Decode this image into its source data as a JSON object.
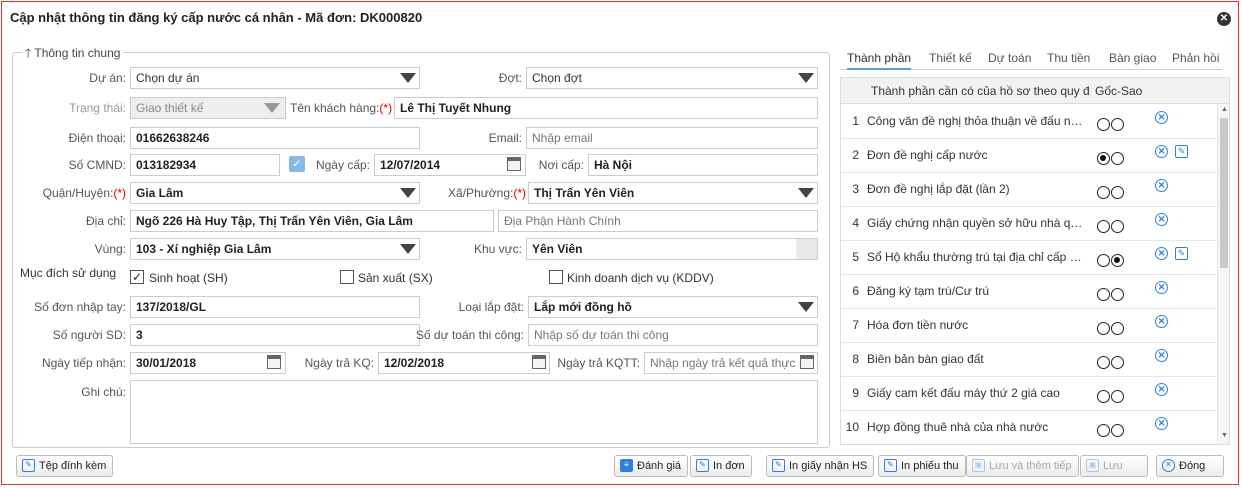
{
  "dialog": {
    "title": "Cập nhật thông tin đăng ký cấp nước cá nhân - Mã đơn: DK000820",
    "close_icon": "close-circle-icon"
  },
  "general": {
    "legend": "Thông tin chung",
    "du_an": {
      "label": "Dự án:",
      "value": "Chọn dự án"
    },
    "dot": {
      "label": "Đợt:",
      "value": "Chọn đợt"
    },
    "trang_thai": {
      "label": "Trạng thái:",
      "value": "Giao thiết kế"
    },
    "ten_kh": {
      "label": "Tên khách hàng:",
      "req": "(*)",
      "value": "Lê Thị Tuyết Nhung"
    },
    "dien_thoai": {
      "label": "Điện thoại:",
      "value": "01662638246"
    },
    "email": {
      "label": "Email:",
      "placeholder": "Nhập email"
    },
    "cmnd": {
      "label": "Số CMND:",
      "value": "013182934"
    },
    "ngay_cap": {
      "label": "Ngày cấp:",
      "value": "12/07/2014"
    },
    "noi_cap": {
      "label": "Nơi cấp:",
      "value": "Hà Nội"
    },
    "quan_huyen": {
      "label": "Quận/Huyện:",
      "req": "(*)",
      "value": "Gia Lâm"
    },
    "xa_phuong": {
      "label": "Xã/Phường:",
      "req": "(*)",
      "value": "Thị Trấn Yên Viên"
    },
    "dia_chi": {
      "label": "Địa chỉ:",
      "value": "Ngõ 226 Hà Huy Tập, Thị Trấn Yên Viên, Gia Lâm",
      "admin_placeholder": "Địa Phận Hành Chính"
    },
    "vung": {
      "label": "Vùng:",
      "value": "103 - Xí nghiệp Gia Lâm"
    },
    "khu_vuc": {
      "label": "Khu vực:",
      "value": "Yên Viên"
    },
    "muc_dich": {
      "label": "Mục đích sử dụng",
      "options": [
        {
          "label": "Sinh hoạt (SH)",
          "checked": true
        },
        {
          "label": "Sản xuất (SX)",
          "checked": false
        },
        {
          "label": "Kinh doanh dịch vụ (KDDV)",
          "checked": false
        }
      ]
    },
    "so_don": {
      "label": "Số đơn nhập tay:",
      "value": "137/2018/GL"
    },
    "loai_lap_dat": {
      "label": "Loại lắp đặt:",
      "value": "Lắp mới đồng hồ"
    },
    "so_nguoi": {
      "label": "Số người SD:",
      "value": "3"
    },
    "so_du_toan": {
      "label": "Số dự toán thi công:",
      "placeholder": "Nhập số dự toán thi công"
    },
    "ngay_tiep_nhan": {
      "label": "Ngày tiếp nhận:",
      "value": "30/01/2018"
    },
    "ngay_tra_kq": {
      "label": "Ngày trả KQ:",
      "value": "12/02/2018"
    },
    "ngay_tra_kqtt": {
      "label": "Ngày trả KQTT:",
      "placeholder": "Nhập ngày trả kết quả thực"
    },
    "ghi_chu": {
      "label": "Ghi chú:",
      "value": ""
    }
  },
  "tabs": [
    "Thành phần",
    "Thiết kế",
    "Dự toán",
    "Thu tiền",
    "Bàn giao",
    "Phản hồi"
  ],
  "components": {
    "headers": {
      "name": "Thành phần cần có của hồ sơ theo quy địn",
      "status": "Gốc-Sao"
    },
    "rows": [
      {
        "n": "1",
        "text": "Công văn đề nghị thỏa thuận về đấu nố...",
        "goc": false,
        "sao": false,
        "edit": false
      },
      {
        "n": "2",
        "text": "Đơn đề nghị cấp nước",
        "goc": true,
        "sao": false,
        "edit": true
      },
      {
        "n": "3",
        "text": "Đơn đề nghị lắp đặt (lần 2)",
        "goc": false,
        "sao": false,
        "edit": false
      },
      {
        "n": "4",
        "text": "Giấy chứng nhận quyền sở hữu nhà qu...",
        "goc": false,
        "sao": false,
        "edit": false
      },
      {
        "n": "5",
        "text": "Sổ Hộ khẩu thường trú tại địa chỉ cấp n...",
        "goc": false,
        "sao": true,
        "edit": true
      },
      {
        "n": "6",
        "text": "Đăng ký tạm trú/Cư trú",
        "goc": false,
        "sao": false,
        "edit": false
      },
      {
        "n": "7",
        "text": "Hóa đơn tiền nước",
        "goc": false,
        "sao": false,
        "edit": false
      },
      {
        "n": "8",
        "text": "Biên bản bàn giao đất",
        "goc": false,
        "sao": false,
        "edit": false
      },
      {
        "n": "9",
        "text": "Giấy cam kết đấu máy thứ 2 giá cao",
        "goc": false,
        "sao": false,
        "edit": false
      },
      {
        "n": "10",
        "text": "Hợp đồng thuê nhà của nhà nước",
        "goc": false,
        "sao": false,
        "edit": false
      }
    ]
  },
  "buttons": {
    "attachments": "Tệp đính kèm",
    "evaluate": "Đánh giá",
    "print_form": "In đơn",
    "print_receipt_hs": "In giấy nhận HS",
    "print_bill": "In phiếu thu",
    "save_add": "Lưu và thêm tiếp",
    "save": "Lưu",
    "close": "Đóng"
  }
}
